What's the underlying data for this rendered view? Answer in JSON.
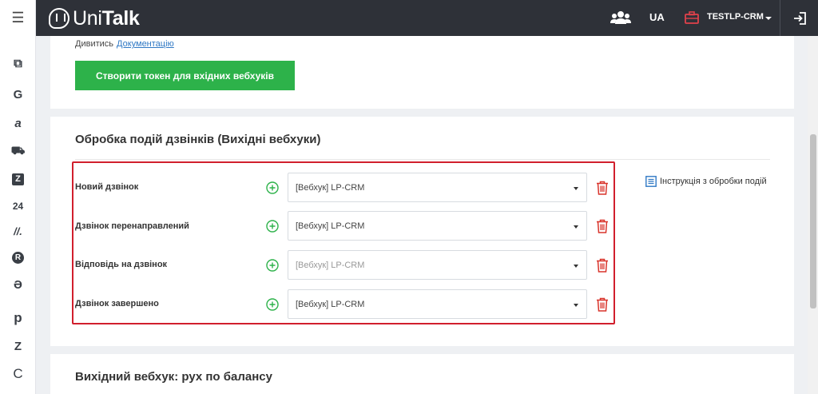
{
  "app": {
    "logo_prefix": "Uni",
    "logo_suffix": "Talk"
  },
  "topbar": {
    "lang": "UA",
    "account": "TESTLP-CRM"
  },
  "sidebar": {
    "items": [
      {
        "name": "copy-icon",
        "glyph": "⧉"
      },
      {
        "name": "google-icon",
        "glyph": "G"
      },
      {
        "name": "amo-icon",
        "glyph": "a"
      },
      {
        "name": "cart-icon",
        "glyph": "⛟"
      },
      {
        "name": "zoho-icon",
        "glyph": "Z"
      },
      {
        "name": "bitrix24-icon",
        "glyph": "24"
      },
      {
        "name": "monday-icon",
        "glyph": "//."
      },
      {
        "name": "retailcrm-icon",
        "glyph": "R"
      },
      {
        "name": "keycrm-icon",
        "glyph": "Ə"
      },
      {
        "name": "pipedrive-icon",
        "glyph": "p"
      },
      {
        "name": "zendesk-icon",
        "glyph": "Z"
      },
      {
        "name": "salesdrive-icon",
        "glyph": "C"
      }
    ]
  },
  "card_token": {
    "docs_prefix": "Дивитись",
    "docs_link": "Документацію",
    "button": "Створити токен для вхідних вебхуків"
  },
  "card_events": {
    "title": "Обробка подій дзвінків (Вихідні вебхуки)",
    "instruction": "Інструкція з обробки подій",
    "rows": [
      {
        "label": "Новий дзвінок",
        "value": "[Вебхук] LP-CRM",
        "dim": false
      },
      {
        "label": "Дзвінок перенаправлений",
        "value": "[Вебхук] LP-CRM",
        "dim": false
      },
      {
        "label": "Відповідь на дзвінок",
        "value": "[Вебхук] LP-CRM",
        "dim": true
      },
      {
        "label": "Дзвінок завершено",
        "value": "[Вебхук] LP-CRM",
        "dim": false
      }
    ]
  },
  "card_balance": {
    "title": "Вихідний вебхук: рух по балансу"
  },
  "colors": {
    "accent_green": "#2db24a",
    "topbar": "#2e3138",
    "highlight_red": "#d11f2d",
    "delete_red": "#d9342b",
    "link_blue": "#2f78c4"
  }
}
